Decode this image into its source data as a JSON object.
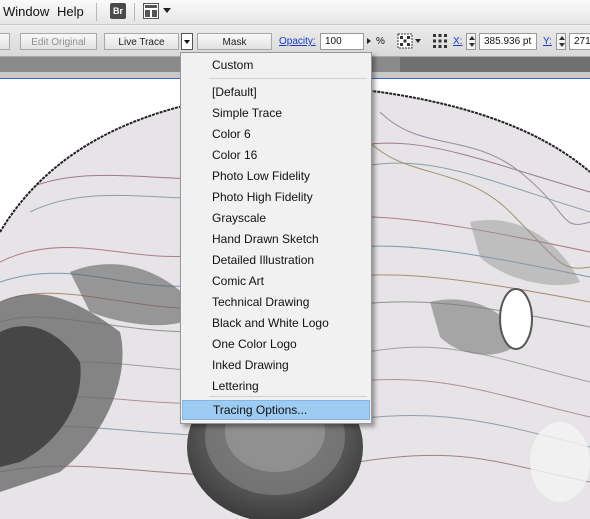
{
  "menubar": {
    "items": [
      "Window",
      "Help"
    ],
    "bridge_label": "Br"
  },
  "control_bar": {
    "edit_original_label": "Edit Original",
    "live_trace_label": "Live Trace",
    "mask_label": "Mask",
    "opacity_label": "Opacity:",
    "opacity_value": "100",
    "percent_sign": "%",
    "x_label": "X:",
    "x_value": "385.936 pt",
    "y_label": "Y:",
    "y_value": "271"
  },
  "trace_presets_menu": {
    "top_item": "Custom",
    "presets": [
      "[Default]",
      "Simple Trace",
      "Color 6",
      "Color 16",
      "Photo Low Fidelity",
      "Photo High Fidelity",
      "Grayscale",
      "Hand Drawn Sketch",
      "Detailed Illustration",
      "Comic Art",
      "Technical Drawing",
      "Black and White Logo",
      "One Color Logo",
      "Inked Drawing",
      "Lettering"
    ],
    "bottom_item": "Tracing Options..."
  },
  "colors": {
    "highlight": "#9ecbf2",
    "link": "#1a3bbf",
    "artboard_border": "#3a66c6"
  }
}
